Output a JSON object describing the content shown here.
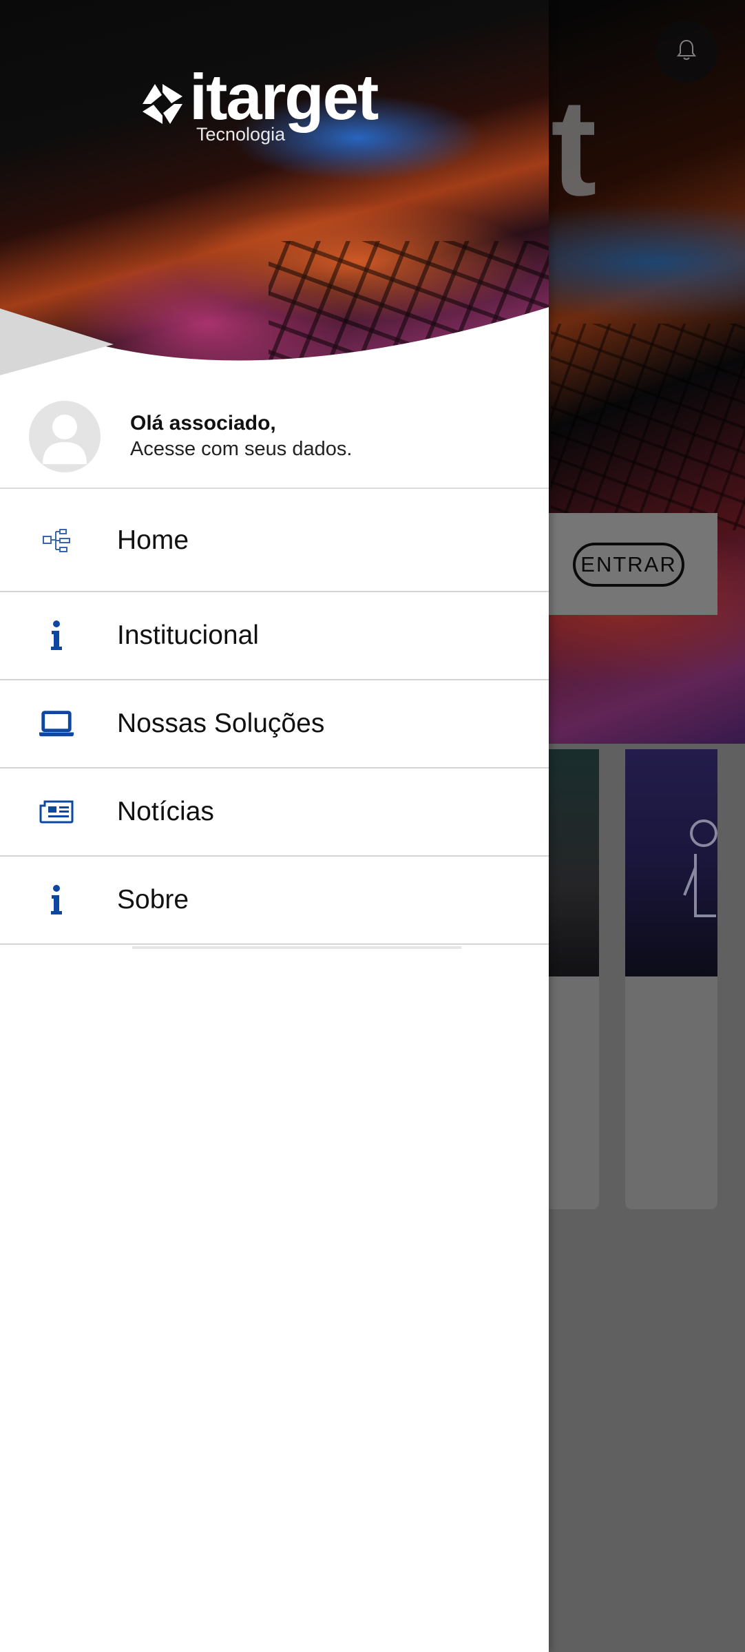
{
  "brand": {
    "name": "itarget",
    "tagline": "Tecnologia"
  },
  "user": {
    "greeting": "Olá associado,",
    "prompt": "Acesse com seus dados."
  },
  "menu": {
    "items": [
      {
        "label": "Home",
        "icon": "sitemap-icon"
      },
      {
        "label": "Institucional",
        "icon": "info-icon"
      },
      {
        "label": "Nossas Soluções",
        "icon": "laptop-icon"
      },
      {
        "label": "Notícias",
        "icon": "newspaper-icon"
      },
      {
        "label": "Sobre",
        "icon": "info-icon"
      }
    ]
  },
  "background": {
    "hero_letter": "t",
    "login_button": "ENTRAR",
    "notification_icon": "bell-icon"
  },
  "colors": {
    "icon_blue": "#0d47a1",
    "drawer_bg": "#ffffff",
    "scrim": "rgba(0,0,0,0.38)"
  }
}
